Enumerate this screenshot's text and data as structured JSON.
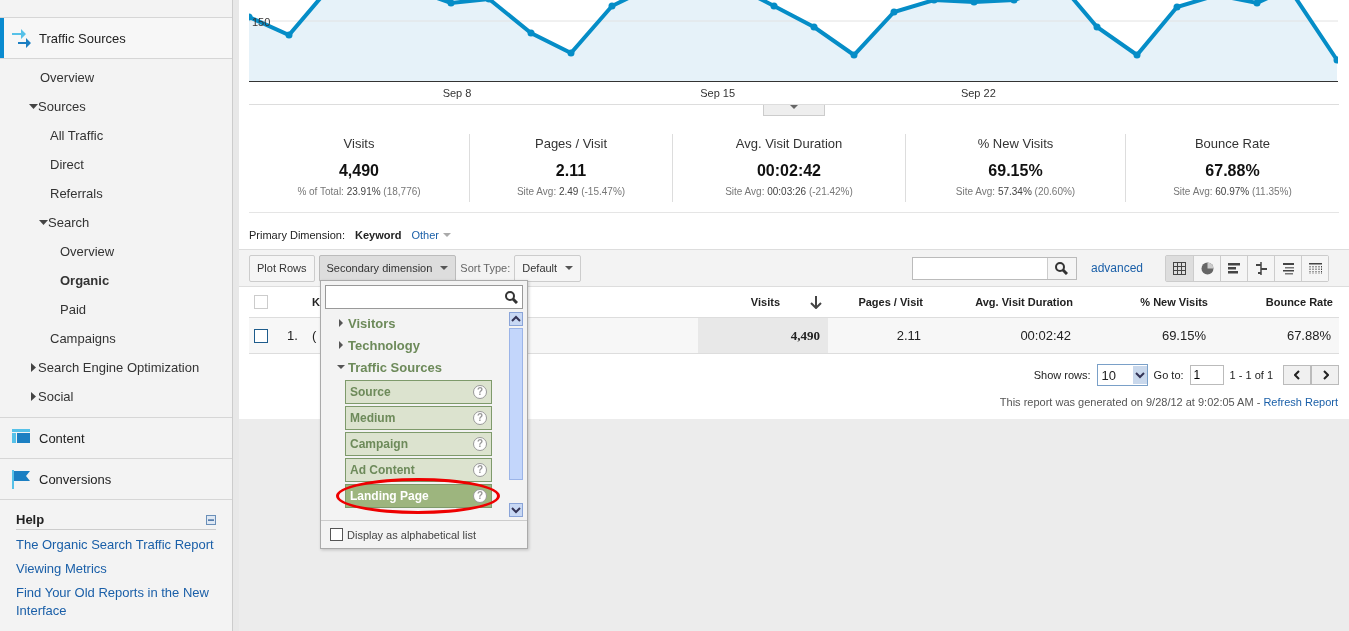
{
  "sidebar": {
    "sections": [
      {
        "label": "Traffic Sources",
        "selected": true,
        "kind": "traffic",
        "children": [
          {
            "label": "Overview",
            "kind": "link",
            "selected": false
          },
          {
            "label": "Sources",
            "kind": "group",
            "expanded": true,
            "children": [
              {
                "label": "All Traffic",
                "kind": "link",
                "selected": false
              },
              {
                "label": "Direct",
                "kind": "link",
                "selected": false
              },
              {
                "label": "Referrals",
                "kind": "link",
                "selected": false
              },
              {
                "label": "Search",
                "kind": "group",
                "expanded": true,
                "children": [
                  {
                    "label": "Overview",
                    "kind": "link",
                    "selected": false
                  },
                  {
                    "label": "Organic",
                    "kind": "link",
                    "selected": true
                  },
                  {
                    "label": "Paid",
                    "kind": "link",
                    "selected": false
                  }
                ]
              },
              {
                "label": "Campaigns",
                "kind": "link",
                "selected": false
              }
            ]
          },
          {
            "label": "Search Engine Optimization",
            "kind": "group",
            "expanded": false
          },
          {
            "label": "Social",
            "kind": "group",
            "expanded": false
          }
        ]
      },
      {
        "label": "Content",
        "selected": false,
        "kind": "content"
      },
      {
        "label": "Conversions",
        "selected": false,
        "kind": "conversions"
      }
    ],
    "help": {
      "title": "Help",
      "expanded": true,
      "links": [
        "The Organic Search Traffic Report",
        "Viewing Metrics",
        "Find Your Old Reports in the New Interface"
      ]
    }
  },
  "chart": {
    "y_label": "150",
    "x_labels": [
      "Sep 8",
      "Sep 15",
      "Sep 22"
    ]
  },
  "scorecards": [
    {
      "label": "Visits",
      "value": "4,490",
      "note": "% of Total: **23.91%** (18,776)"
    },
    {
      "label": "Pages / Visit",
      "value": "2.11",
      "note": "Site Avg: **2.49** (-15.47%)"
    },
    {
      "label": "Avg. Visit Duration",
      "value": "00:02:42",
      "note": "Site Avg: **00:03:26** (-21.42%)"
    },
    {
      "label": "% New Visits",
      "value": "69.15%",
      "note": "Site Avg: **57.34%** (20.60%)"
    },
    {
      "label": "Bounce Rate",
      "value": "67.88%",
      "note": "Site Avg: **60.97%** (11.35%)"
    }
  ],
  "primary_dimension": {
    "label": "Primary Dimension:",
    "value": "Keyword",
    "other": "Other"
  },
  "toolbar": {
    "plot_rows": "Plot Rows",
    "secondary": "Secondary dimension",
    "sort_label": "Sort Type:",
    "sort_value": "Default",
    "advanced": "advanced",
    "views": [
      {
        "kind": "table",
        "selected": true
      },
      {
        "kind": "pie",
        "selected": false
      },
      {
        "kind": "bars",
        "selected": false
      },
      {
        "kind": "comparison",
        "selected": false
      },
      {
        "kind": "pivot",
        "selected": false
      },
      {
        "kind": "cloud",
        "selected": false
      }
    ]
  },
  "table": {
    "all_selected": false,
    "columns": [
      "K",
      "Visits",
      "Pages / Visit",
      "Avg. Visit Duration",
      "% New Visits",
      "Bounce Rate"
    ],
    "rows": [
      {
        "selected": false,
        "index": "1.",
        "cells": [
          "(",
          "4,490",
          "2.11",
          "00:02:42",
          "69.15%",
          "67.88%"
        ]
      }
    ]
  },
  "pagination": {
    "show_rows_label": "Show rows:",
    "rows_value": "10",
    "goto_label": "Go to:",
    "goto_value": "1",
    "range": "1 - 1 of 1"
  },
  "report_note": {
    "text": "This report was generated on 9/28/12 at 9:02:05 AM - ",
    "link": "Refresh Report"
  },
  "dropdown": {
    "groups": [
      {
        "label": "Visitors",
        "expanded": false
      },
      {
        "label": "Technology",
        "expanded": false
      },
      {
        "label": "Traffic Sources",
        "expanded": true,
        "items": [
          {
            "label": "Source",
            "hint": "?",
            "selected": false,
            "circled": false
          },
          {
            "label": "Medium",
            "hint": "?",
            "selected": false,
            "circled": false
          },
          {
            "label": "Campaign",
            "hint": "?",
            "selected": false,
            "circled": false
          },
          {
            "label": "Ad Content",
            "hint": "?",
            "selected": false,
            "circled": false
          },
          {
            "label": "Landing Page",
            "hint": "?",
            "selected": true,
            "circled": true
          }
        ]
      }
    ],
    "alphabetical": {
      "label": "Display as alphabetical list",
      "checked": false
    }
  }
}
